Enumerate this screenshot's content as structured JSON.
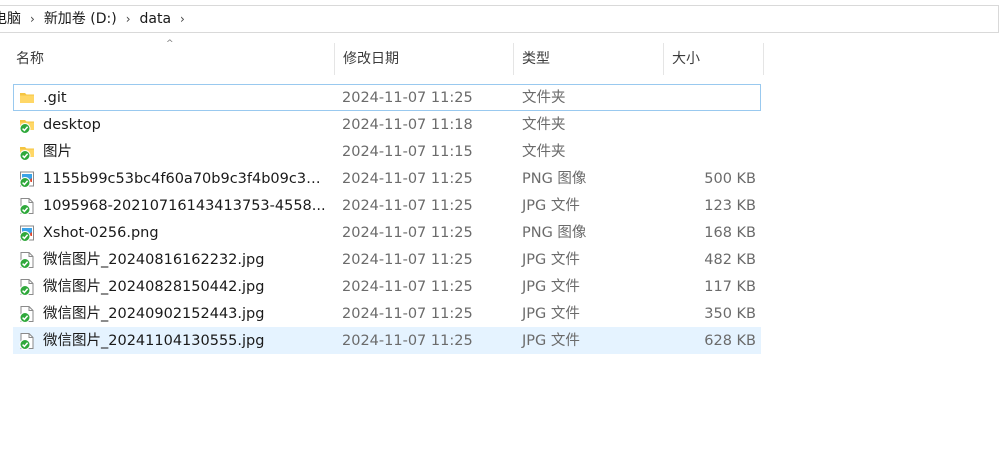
{
  "breadcrumb": {
    "items": [
      {
        "label": "电脑"
      },
      {
        "label": "新加卷 (D:)"
      },
      {
        "label": "data"
      }
    ],
    "separator": "›"
  },
  "columns": {
    "sort_indicator": "^",
    "name": "名称",
    "date": "修改日期",
    "type": "类型",
    "size": "大小"
  },
  "colors": {
    "selection": "#e5f3ff",
    "focus_border": "#99c9ef",
    "folder": "#f5c542",
    "sync_check": "#2fa83b"
  },
  "files": [
    {
      "icon": "folder-icon",
      "name": ".git",
      "date": "2024-11-07 11:25",
      "type": "文件夹",
      "size": "",
      "sync": false,
      "state": "focused"
    },
    {
      "icon": "folder-icon",
      "name": "desktop",
      "date": "2024-11-07 11:18",
      "type": "文件夹",
      "size": "",
      "sync": true,
      "state": ""
    },
    {
      "icon": "folder-icon",
      "name": "图片",
      "date": "2024-11-07 11:15",
      "type": "文件夹",
      "size": "",
      "sync": true,
      "state": ""
    },
    {
      "icon": "png-image-icon",
      "name": "1155b99c53bc4f60a70b9c3f4b09c3a...",
      "date": "2024-11-07 11:25",
      "type": "PNG 图像",
      "size": "500 KB",
      "sync": true,
      "state": ""
    },
    {
      "icon": "jpg-file-icon",
      "name": "1095968-20210716143413753-4558...",
      "date": "2024-11-07 11:25",
      "type": "JPG 文件",
      "size": "123 KB",
      "sync": true,
      "state": ""
    },
    {
      "icon": "png-image-icon",
      "name": "Xshot-0256.png",
      "date": "2024-11-07 11:25",
      "type": "PNG 图像",
      "size": "168 KB",
      "sync": true,
      "state": ""
    },
    {
      "icon": "jpg-file-icon",
      "name": "微信图片_20240816162232.jpg",
      "date": "2024-11-07 11:25",
      "type": "JPG 文件",
      "size": "482 KB",
      "sync": true,
      "state": ""
    },
    {
      "icon": "jpg-file-icon",
      "name": "微信图片_20240828150442.jpg",
      "date": "2024-11-07 11:25",
      "type": "JPG 文件",
      "size": "117 KB",
      "sync": true,
      "state": ""
    },
    {
      "icon": "jpg-file-icon",
      "name": "微信图片_20240902152443.jpg",
      "date": "2024-11-07 11:25",
      "type": "JPG 文件",
      "size": "350 KB",
      "sync": true,
      "state": ""
    },
    {
      "icon": "jpg-file-icon",
      "name": "微信图片_20241104130555.jpg",
      "date": "2024-11-07 11:25",
      "type": "JPG 文件",
      "size": "628 KB",
      "sync": true,
      "state": "selected"
    }
  ]
}
